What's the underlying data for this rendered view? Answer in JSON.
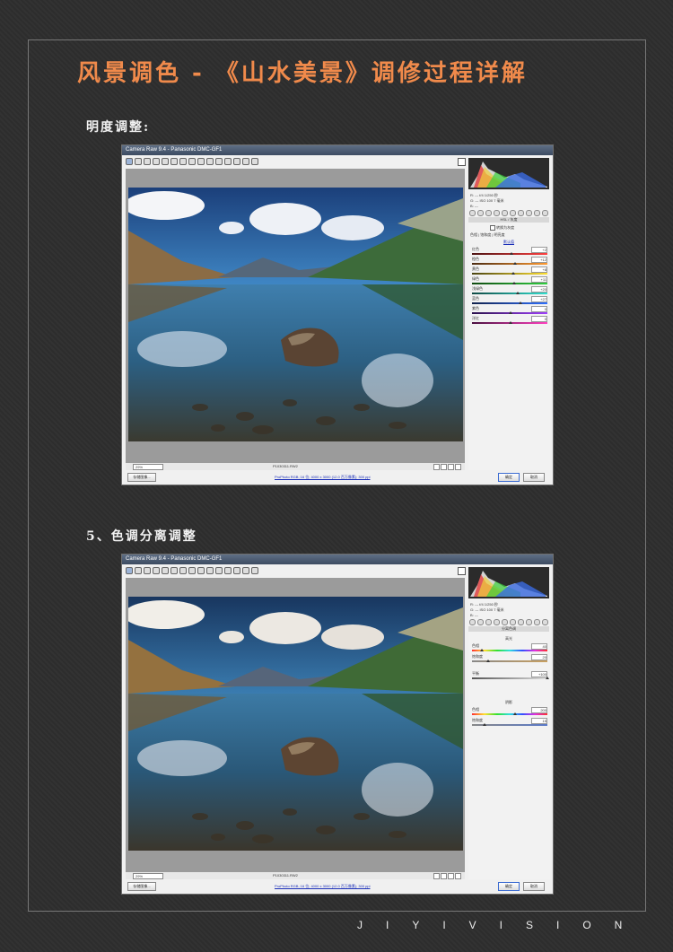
{
  "page": {
    "title": "风景调色 - 《山水美景》调修过程详解",
    "brand": "JIYIVISION"
  },
  "sections": [
    {
      "label": "明度调整:",
      "window": {
        "title": "Camera Raw 9.4 - Panasonic DMC-GF1",
        "zoom": "29%",
        "filename": "P1030311.RW2",
        "workflow": "ProPhoto RGB; 16 位; 4000 x 3000 (12.0 百万像素); 300 ppi",
        "save_label": "存储图像...",
        "ok_label": "确定",
        "cancel_label": "取消",
        "readout": [
          "R:  ---   f/4  1/250 秒",
          "G:  ---   ISO 100  7 毫米",
          "B:  ---"
        ],
        "panel_title": "HSL / 灰度",
        "gray_checkbox": "转换为灰度",
        "tabs": "色相 | 饱和度 | 明亮度",
        "default_link": "默认值",
        "sliders": [
          {
            "label": "红色",
            "value": "+2",
            "level": 0.51
          },
          {
            "label": "橙色",
            "value": "+12",
            "level": 0.56
          },
          {
            "label": "黄色",
            "value": "+8",
            "level": 0.54
          },
          {
            "label": "绿色",
            "value": "+11",
            "level": 0.55
          },
          {
            "label": "浅绿色",
            "value": "+20",
            "level": 0.6
          },
          {
            "label": "蓝色",
            "value": "+27",
            "level": 0.63
          },
          {
            "label": "紫色",
            "value": "0",
            "level": 0.5
          },
          {
            "label": "洋红",
            "value": "0",
            "level": 0.5
          }
        ]
      }
    },
    {
      "label": "5、色调分离调整",
      "window": {
        "title": "Camera Raw 9.4 - Panasonic DMC-GF1",
        "zoom": "29%",
        "filename": "P1030311.RW2",
        "workflow": "ProPhoto RGB; 16 位; 4000 x 3000 (12.0 百万像素); 300 ppi",
        "save_label": "存储图像...",
        "ok_label": "确定",
        "cancel_label": "取消",
        "readout": [
          "R:  ---   f/4  1/250 秒",
          "G:  ---   ISO 100  7 毫米",
          "B:  ---"
        ],
        "panel_title": "分离色调",
        "highlights_title": "高光",
        "shadows_title": "阴影",
        "hl_sliders": [
          {
            "label": "色相",
            "value": "40",
            "level": 0.11
          },
          {
            "label": "饱和度",
            "value": "20",
            "level": 0.2
          }
        ],
        "balance": {
          "label": "平衡",
          "value": "+100",
          "level": 1.0
        },
        "sh_sliders": [
          {
            "label": "色相",
            "value": "200",
            "level": 0.56
          },
          {
            "label": "饱和度",
            "value": "15",
            "level": 0.15
          }
        ]
      }
    }
  ]
}
